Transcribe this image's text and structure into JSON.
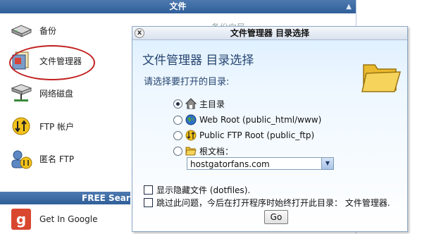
{
  "panel": {
    "title": "文件",
    "collapse_glyph": "▲",
    "items": [
      {
        "label": "备份",
        "icon": "backup-drive-icon"
      },
      {
        "label": "文件管理器",
        "icon": "file-manager-icon"
      },
      {
        "label": "网络磁盘",
        "icon": "network-disk-icon"
      },
      {
        "label": "FTP 帐户",
        "icon": "ftp-accounts-icon"
      },
      {
        "label": "匿名 FTP",
        "icon": "anonymous-ftp-icon"
      }
    ],
    "behind_text": "备份向导",
    "free_section": {
      "title": "FREE Search",
      "items": [
        {
          "label": "Get In Google",
          "icon": "google-icon"
        }
      ]
    }
  },
  "dialog": {
    "title": "文件管理器 目录选择",
    "close_glyph": "x",
    "heading": "文件管理器 目录选择",
    "prompt": "请选择要打开的目录:",
    "options": [
      {
        "label": "主目录",
        "icon": "home-icon",
        "checked": true
      },
      {
        "label": "Web Root (public_html/www)",
        "icon": "globe-icon",
        "checked": false
      },
      {
        "label": "Public FTP Root (public_ftp)",
        "icon": "ftp-arrows-icon",
        "checked": false
      },
      {
        "label": "根文档：",
        "icon": "folder-icon",
        "checked": false
      }
    ],
    "domain_select": {
      "value": "hostgatorfans.com"
    },
    "show_hidden_label": "显示隐藏文件 (dotfiles).",
    "skip_question_label": "跳过此问题，今后在打开程序时始终打开此目录： 文件管理器.",
    "go_label": "Go"
  },
  "colors": {
    "header_blue": "#3f6ca6",
    "highlight_red": "#c22020",
    "heading_blue": "#27456f"
  }
}
